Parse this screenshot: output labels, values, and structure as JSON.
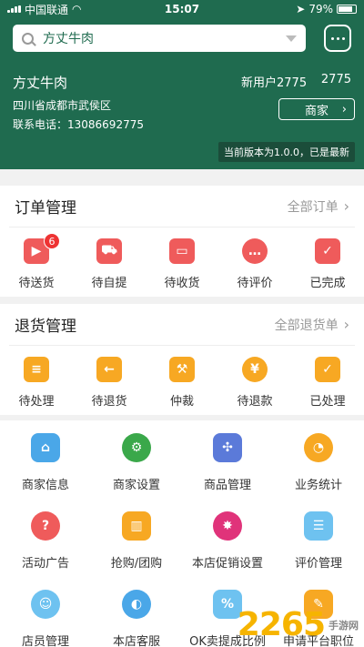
{
  "status": {
    "carrier": "中国联通",
    "time": "15:07",
    "battery": "79%"
  },
  "search": {
    "value": "方丈牛肉"
  },
  "shop": {
    "name": "方丈牛肉",
    "address": "四川省成都市武侯区",
    "phone": "联系电话：13086692775",
    "new_users_label": "新用户2775",
    "new_users_count": "2775",
    "merchant_button": "商家",
    "version": "当前版本为1.0.0，已是最新"
  },
  "orders": {
    "title": "订单管理",
    "more": "全部订单",
    "items": [
      {
        "label": "待送货",
        "icon": "truck-icon",
        "badge": "6"
      },
      {
        "label": "待自提",
        "icon": "cart-icon"
      },
      {
        "label": "待收货",
        "icon": "box-icon"
      },
      {
        "label": "待评价",
        "icon": "comment-icon"
      },
      {
        "label": "已完成",
        "icon": "done-icon"
      }
    ]
  },
  "returns": {
    "title": "退货管理",
    "more": "全部退货单",
    "items": [
      {
        "label": "待处理",
        "icon": "clock-doc-icon"
      },
      {
        "label": "待退货",
        "icon": "return-icon"
      },
      {
        "label": "仲裁",
        "icon": "gavel-icon"
      },
      {
        "label": "待退款",
        "icon": "yen-icon"
      },
      {
        "label": "已处理",
        "icon": "check-icon"
      }
    ]
  },
  "grid": [
    {
      "label": "商家信息",
      "icon": "store-icon"
    },
    {
      "label": "商家设置",
      "icon": "gear-icon"
    },
    {
      "label": "商品管理",
      "icon": "product-grid-icon"
    },
    {
      "label": "业务统计",
      "icon": "pie-chart-icon"
    },
    {
      "label": "活动广告",
      "icon": "balloon-icon"
    },
    {
      "label": "抢购/团购",
      "icon": "shopping-bag-icon"
    },
    {
      "label": "本店促销设置",
      "icon": "promo-icon"
    },
    {
      "label": "评价管理",
      "icon": "review-icon"
    },
    {
      "label": "店员管理",
      "icon": "staff-icon"
    },
    {
      "label": "本店客服",
      "icon": "service-icon"
    },
    {
      "label": "OK卖提成比例",
      "icon": "percent-icon"
    },
    {
      "label": "申请平台职位",
      "icon": "apply-icon"
    }
  ],
  "watermark": {
    "number": "2265",
    "text": "手游网"
  },
  "colors": {
    "header": "#1f6b4f",
    "order_icons": "#ef5b5b",
    "return_icons": "#f7a823"
  }
}
